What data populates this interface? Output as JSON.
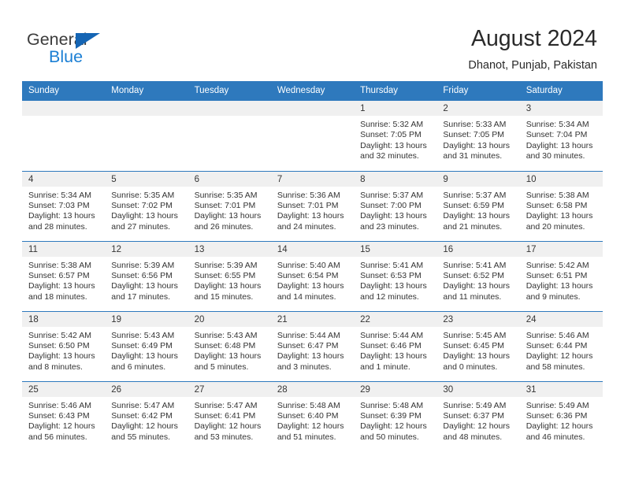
{
  "brand": {
    "name_part1": "General",
    "name_part2": "Blue",
    "color_dark": "#3c3c3c",
    "color_blue": "#1b7fd4",
    "triangle_color": "#1565b4"
  },
  "header": {
    "title": "August 2024",
    "subtitle": "Dhanot, Punjab, Pakistan",
    "accent_color": "#2e79bd"
  },
  "weekday_headers": [
    "Sunday",
    "Monday",
    "Tuesday",
    "Wednesday",
    "Thursday",
    "Friday",
    "Saturday"
  ],
  "labels": {
    "sunrise_prefix": "Sunrise:",
    "sunset_prefix": "Sunset:",
    "daylight_prefix": "Daylight:"
  },
  "weeks": [
    [
      {
        "day": "",
        "blank": true
      },
      {
        "day": "",
        "blank": true
      },
      {
        "day": "",
        "blank": true
      },
      {
        "day": "",
        "blank": true
      },
      {
        "day": "1",
        "sunrise": "Sunrise: 5:32 AM",
        "sunset": "Sunset: 7:05 PM",
        "daylight_line1": "Daylight: 13 hours",
        "daylight_line2": "and 32 minutes."
      },
      {
        "day": "2",
        "sunrise": "Sunrise: 5:33 AM",
        "sunset": "Sunset: 7:05 PM",
        "daylight_line1": "Daylight: 13 hours",
        "daylight_line2": "and 31 minutes."
      },
      {
        "day": "3",
        "sunrise": "Sunrise: 5:34 AM",
        "sunset": "Sunset: 7:04 PM",
        "daylight_line1": "Daylight: 13 hours",
        "daylight_line2": "and 30 minutes."
      }
    ],
    [
      {
        "day": "4",
        "sunrise": "Sunrise: 5:34 AM",
        "sunset": "Sunset: 7:03 PM",
        "daylight_line1": "Daylight: 13 hours",
        "daylight_line2": "and 28 minutes."
      },
      {
        "day": "5",
        "sunrise": "Sunrise: 5:35 AM",
        "sunset": "Sunset: 7:02 PM",
        "daylight_line1": "Daylight: 13 hours",
        "daylight_line2": "and 27 minutes."
      },
      {
        "day": "6",
        "sunrise": "Sunrise: 5:35 AM",
        "sunset": "Sunset: 7:01 PM",
        "daylight_line1": "Daylight: 13 hours",
        "daylight_line2": "and 26 minutes."
      },
      {
        "day": "7",
        "sunrise": "Sunrise: 5:36 AM",
        "sunset": "Sunset: 7:01 PM",
        "daylight_line1": "Daylight: 13 hours",
        "daylight_line2": "and 24 minutes."
      },
      {
        "day": "8",
        "sunrise": "Sunrise: 5:37 AM",
        "sunset": "Sunset: 7:00 PM",
        "daylight_line1": "Daylight: 13 hours",
        "daylight_line2": "and 23 minutes."
      },
      {
        "day": "9",
        "sunrise": "Sunrise: 5:37 AM",
        "sunset": "Sunset: 6:59 PM",
        "daylight_line1": "Daylight: 13 hours",
        "daylight_line2": "and 21 minutes."
      },
      {
        "day": "10",
        "sunrise": "Sunrise: 5:38 AM",
        "sunset": "Sunset: 6:58 PM",
        "daylight_line1": "Daylight: 13 hours",
        "daylight_line2": "and 20 minutes."
      }
    ],
    [
      {
        "day": "11",
        "sunrise": "Sunrise: 5:38 AM",
        "sunset": "Sunset: 6:57 PM",
        "daylight_line1": "Daylight: 13 hours",
        "daylight_line2": "and 18 minutes."
      },
      {
        "day": "12",
        "sunrise": "Sunrise: 5:39 AM",
        "sunset": "Sunset: 6:56 PM",
        "daylight_line1": "Daylight: 13 hours",
        "daylight_line2": "and 17 minutes."
      },
      {
        "day": "13",
        "sunrise": "Sunrise: 5:39 AM",
        "sunset": "Sunset: 6:55 PM",
        "daylight_line1": "Daylight: 13 hours",
        "daylight_line2": "and 15 minutes."
      },
      {
        "day": "14",
        "sunrise": "Sunrise: 5:40 AM",
        "sunset": "Sunset: 6:54 PM",
        "daylight_line1": "Daylight: 13 hours",
        "daylight_line2": "and 14 minutes."
      },
      {
        "day": "15",
        "sunrise": "Sunrise: 5:41 AM",
        "sunset": "Sunset: 6:53 PM",
        "daylight_line1": "Daylight: 13 hours",
        "daylight_line2": "and 12 minutes."
      },
      {
        "day": "16",
        "sunrise": "Sunrise: 5:41 AM",
        "sunset": "Sunset: 6:52 PM",
        "daylight_line1": "Daylight: 13 hours",
        "daylight_line2": "and 11 minutes."
      },
      {
        "day": "17",
        "sunrise": "Sunrise: 5:42 AM",
        "sunset": "Sunset: 6:51 PM",
        "daylight_line1": "Daylight: 13 hours",
        "daylight_line2": "and 9 minutes."
      }
    ],
    [
      {
        "day": "18",
        "sunrise": "Sunrise: 5:42 AM",
        "sunset": "Sunset: 6:50 PM",
        "daylight_line1": "Daylight: 13 hours",
        "daylight_line2": "and 8 minutes."
      },
      {
        "day": "19",
        "sunrise": "Sunrise: 5:43 AM",
        "sunset": "Sunset: 6:49 PM",
        "daylight_line1": "Daylight: 13 hours",
        "daylight_line2": "and 6 minutes."
      },
      {
        "day": "20",
        "sunrise": "Sunrise: 5:43 AM",
        "sunset": "Sunset: 6:48 PM",
        "daylight_line1": "Daylight: 13 hours",
        "daylight_line2": "and 5 minutes."
      },
      {
        "day": "21",
        "sunrise": "Sunrise: 5:44 AM",
        "sunset": "Sunset: 6:47 PM",
        "daylight_line1": "Daylight: 13 hours",
        "daylight_line2": "and 3 minutes."
      },
      {
        "day": "22",
        "sunrise": "Sunrise: 5:44 AM",
        "sunset": "Sunset: 6:46 PM",
        "daylight_line1": "Daylight: 13 hours",
        "daylight_line2": "and 1 minute."
      },
      {
        "day": "23",
        "sunrise": "Sunrise: 5:45 AM",
        "sunset": "Sunset: 6:45 PM",
        "daylight_line1": "Daylight: 13 hours",
        "daylight_line2": "and 0 minutes."
      },
      {
        "day": "24",
        "sunrise": "Sunrise: 5:46 AM",
        "sunset": "Sunset: 6:44 PM",
        "daylight_line1": "Daylight: 12 hours",
        "daylight_line2": "and 58 minutes."
      }
    ],
    [
      {
        "day": "25",
        "sunrise": "Sunrise: 5:46 AM",
        "sunset": "Sunset: 6:43 PM",
        "daylight_line1": "Daylight: 12 hours",
        "daylight_line2": "and 56 minutes."
      },
      {
        "day": "26",
        "sunrise": "Sunrise: 5:47 AM",
        "sunset": "Sunset: 6:42 PM",
        "daylight_line1": "Daylight: 12 hours",
        "daylight_line2": "and 55 minutes."
      },
      {
        "day": "27",
        "sunrise": "Sunrise: 5:47 AM",
        "sunset": "Sunset: 6:41 PM",
        "daylight_line1": "Daylight: 12 hours",
        "daylight_line2": "and 53 minutes."
      },
      {
        "day": "28",
        "sunrise": "Sunrise: 5:48 AM",
        "sunset": "Sunset: 6:40 PM",
        "daylight_line1": "Daylight: 12 hours",
        "daylight_line2": "and 51 minutes."
      },
      {
        "day": "29",
        "sunrise": "Sunrise: 5:48 AM",
        "sunset": "Sunset: 6:39 PM",
        "daylight_line1": "Daylight: 12 hours",
        "daylight_line2": "and 50 minutes."
      },
      {
        "day": "30",
        "sunrise": "Sunrise: 5:49 AM",
        "sunset": "Sunset: 6:37 PM",
        "daylight_line1": "Daylight: 12 hours",
        "daylight_line2": "and 48 minutes."
      },
      {
        "day": "31",
        "sunrise": "Sunrise: 5:49 AM",
        "sunset": "Sunset: 6:36 PM",
        "daylight_line1": "Daylight: 12 hours",
        "daylight_line2": "and 46 minutes."
      }
    ]
  ]
}
